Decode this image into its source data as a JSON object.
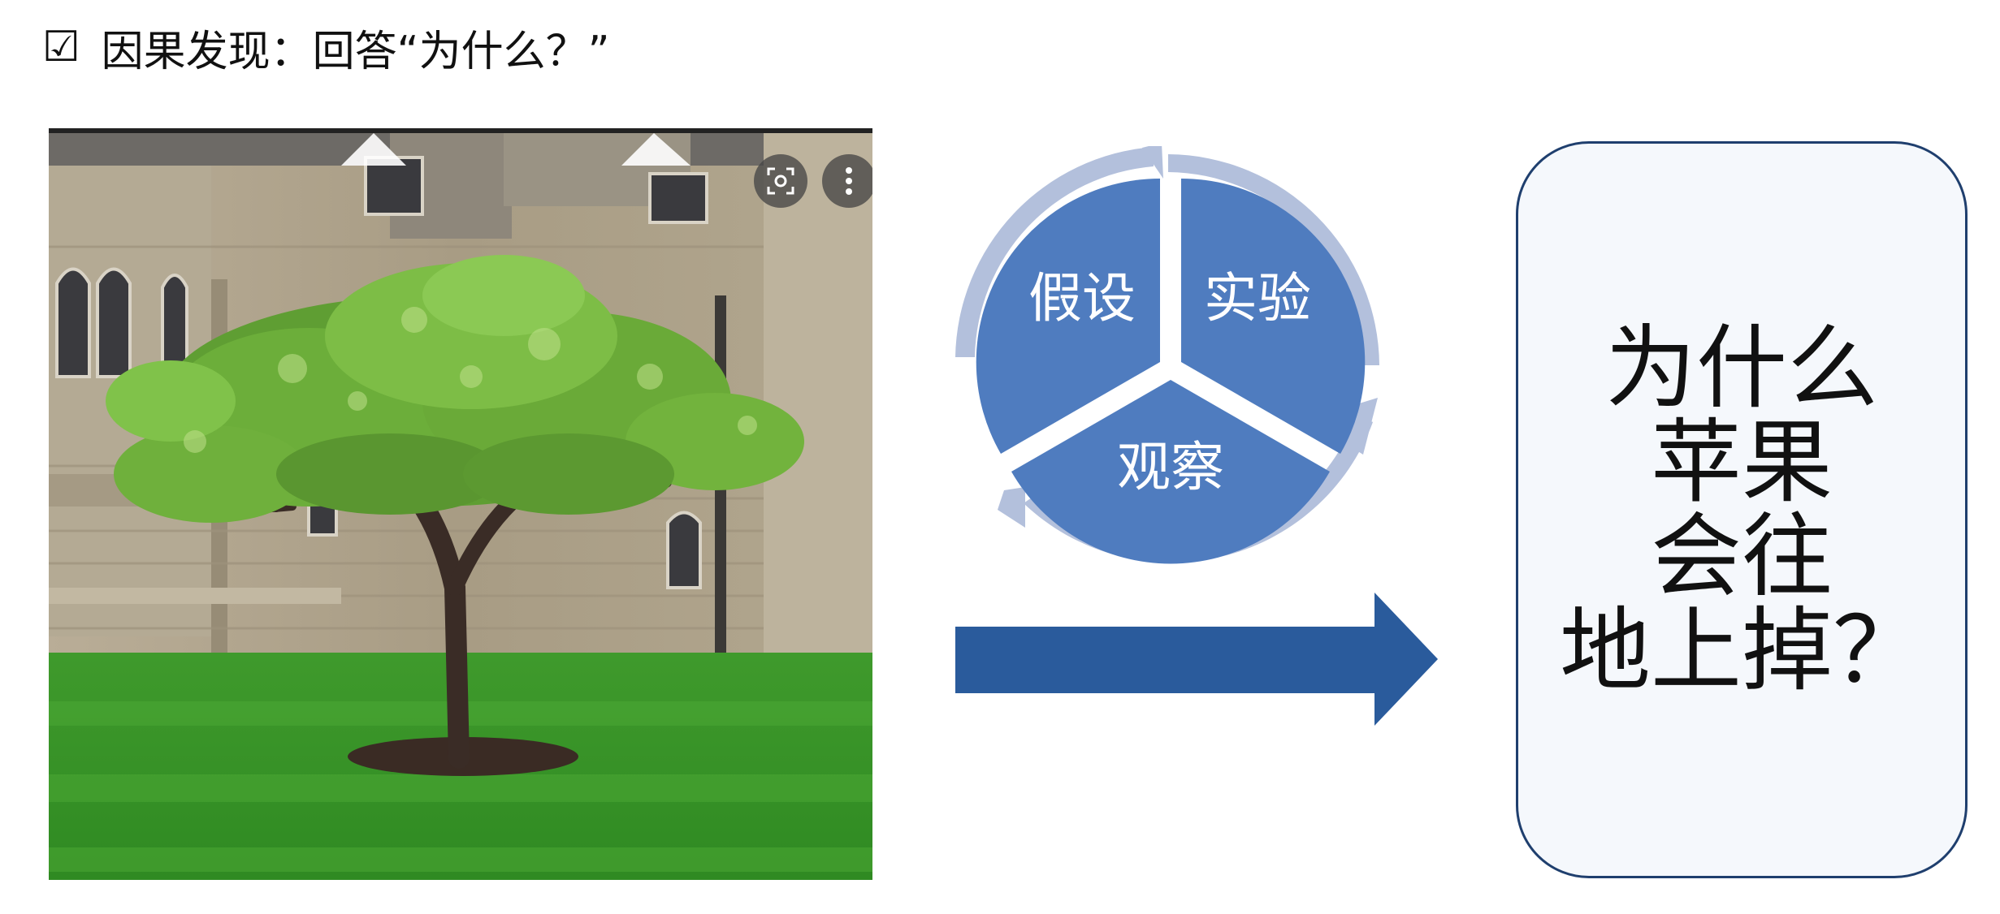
{
  "slide": {
    "heading_check": "☑",
    "heading": "因果发现：回答“为什么？”"
  },
  "cycle": {
    "labels": {
      "hypothesis": "假设",
      "experiment": "实验",
      "observation": "观察"
    },
    "colors": {
      "segment": "#4f7cbf",
      "ring": "#b3c0dc",
      "text": "#ffffff"
    }
  },
  "arrow": {
    "color": "#2a5b9c"
  },
  "answer": {
    "lines": [
      "为什么",
      "苹果",
      "会往",
      "地上掉？"
    ]
  },
  "photo": {
    "icons": [
      "lens-icon",
      "more-vertical-icon"
    ]
  }
}
